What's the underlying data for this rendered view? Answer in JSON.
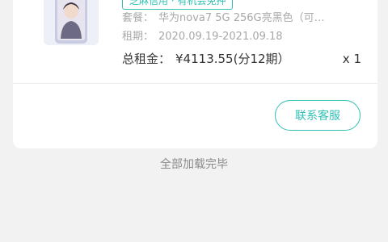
{
  "order": {
    "tag": "芝麻信用 · 有机会免押",
    "plan_label": "套餐：",
    "plan_value": "华为nova7 5G 256G亮黑色（可…",
    "period_label": "租期：",
    "period_value": "2020.09.19-2021.09.18",
    "total_label": "总租金：",
    "total_value": "¥4113.55(分12期）",
    "quantity": "x 1",
    "contact_button": "联系客服"
  },
  "footer": {
    "loaded_text": "全部加载完毕"
  },
  "colors": {
    "accent": "#30c0b6",
    "background": "#f2f2f2",
    "card": "#ffffff"
  }
}
